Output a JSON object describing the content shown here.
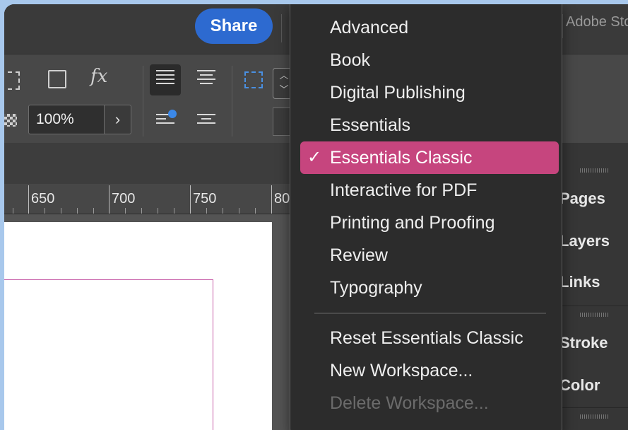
{
  "header": {
    "share_label": "Share",
    "adobe_stock_label": "Adobe Stock"
  },
  "control_panel": {
    "zoom_percent": "100%",
    "percent_arrow": "›",
    "fx_label": "fx"
  },
  "ruler": {
    "labels": [
      "650",
      "700",
      "750",
      "80"
    ]
  },
  "workspace_menu": {
    "items": [
      {
        "label": "Advanced",
        "checked": false,
        "enabled": true
      },
      {
        "label": "Book",
        "checked": false,
        "enabled": true
      },
      {
        "label": "Digital Publishing",
        "checked": false,
        "enabled": true
      },
      {
        "label": "Essentials",
        "checked": false,
        "enabled": true
      },
      {
        "label": "Essentials Classic",
        "checked": true,
        "enabled": true
      },
      {
        "label": "Interactive for PDF",
        "checked": false,
        "enabled": true
      },
      {
        "label": "Printing and Proofing",
        "checked": false,
        "enabled": true
      },
      {
        "label": "Review",
        "checked": false,
        "enabled": true
      },
      {
        "label": "Typography",
        "checked": false,
        "enabled": true
      }
    ],
    "actions": [
      {
        "label": "Reset Essentials Classic",
        "enabled": true
      },
      {
        "label": "New Workspace...",
        "enabled": true
      },
      {
        "label": "Delete Workspace...",
        "enabled": false
      }
    ],
    "check_glyph": "✓",
    "highlight_color": "#c6457e"
  },
  "panels": {
    "labels": [
      "Pages",
      "Layers",
      "Links",
      "Stroke",
      "Color"
    ]
  },
  "colors": {
    "share_button": "#2d6ad0",
    "margin_guide": "#c55aa6",
    "background": "#a8c8ec"
  }
}
